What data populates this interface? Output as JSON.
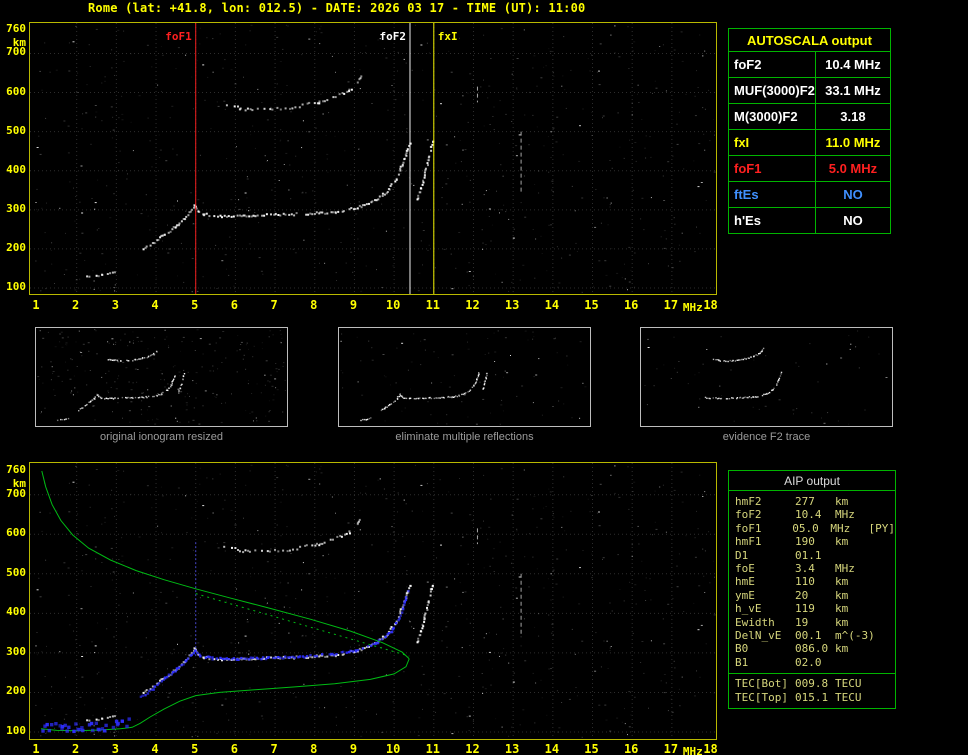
{
  "title": "Rome (lat: +41.8, lon: 012.5) - DATE: 2026 03 17 - TIME (UT): 11:00",
  "colors": {
    "background": "#000000",
    "axis_text": "#ffff00",
    "plot_border": "#b9b900",
    "trace": "#ffffff",
    "restored_trace": "#2e2eff",
    "profile": "#00bb14",
    "table_border": "#00b400",
    "autoscala_title": "#ffff00",
    "aip_text": "#d6d67c",
    "caption": "#9c9c9c"
  },
  "autoscala_table": {
    "title": "AUTOSCALA output",
    "rows": [
      {
        "label": "foF2",
        "value": "10.4 MHz",
        "color": "#ffffff"
      },
      {
        "label": "MUF(3000)F2",
        "value": "33.1 MHz",
        "color": "#ffffff"
      },
      {
        "label": "M(3000)F2",
        "value": "3.18",
        "color": "#ffffff"
      },
      {
        "label": "fxI",
        "value": "11.0 MHz",
        "color": "#ffff00"
      },
      {
        "label": "foF1",
        "value": "5.0 MHz",
        "color": "#ff2020"
      },
      {
        "label": "ftEs",
        "value": "NO",
        "color": "#4090ff"
      },
      {
        "label": "h'Es",
        "value": "NO",
        "color": "#ffffff"
      }
    ]
  },
  "thumbnails": [
    {
      "caption": "original ionogram resized"
    },
    {
      "caption": "eliminate multiple reflections"
    },
    {
      "caption": "evidence F2 trace"
    }
  ],
  "aip_table": {
    "title": "AIP output",
    "rows": [
      {
        "name": "hmF2",
        "value": "277",
        "unit": "km",
        "note": ""
      },
      {
        "name": "foF2",
        "value": "10.4",
        "unit": "MHz",
        "note": ""
      },
      {
        "name": "foF1",
        "value": "05.0",
        "unit": "MHz",
        "note": "[PY]"
      },
      {
        "name": "hmF1",
        "value": "190",
        "unit": "km",
        "note": ""
      },
      {
        "name": "D1",
        "value": "01.1",
        "unit": "",
        "note": ""
      },
      {
        "name": "foE",
        "value": "3.4",
        "unit": "MHz",
        "note": ""
      },
      {
        "name": "hmE",
        "value": "110",
        "unit": "km",
        "note": ""
      },
      {
        "name": "ymE",
        "value": "20",
        "unit": "km",
        "note": ""
      },
      {
        "name": "h_vE",
        "value": "119",
        "unit": "km",
        "note": ""
      },
      {
        "name": "Ewidth",
        "value": "19",
        "unit": "km",
        "note": ""
      },
      {
        "name": "DelN_vE",
        "value": "00.1",
        "unit": "m^(-3)",
        "note": ""
      },
      {
        "name": "B0",
        "value": "086.0",
        "unit": "km",
        "note": ""
      },
      {
        "name": "B1",
        "value": "02.0",
        "unit": "",
        "note": ""
      }
    ],
    "tec_rows": [
      {
        "name": "TEC[Bot]",
        "value": "009.8",
        "unit": "TECU",
        "note": ""
      },
      {
        "name": "TEC[Top]",
        "value": "015.1",
        "unit": "TECU",
        "note": ""
      }
    ]
  },
  "chart_data": {
    "type": "scatter",
    "title": "Ionogram - Rome - 2026 03 17 11:00 UT",
    "xlabel": "MHz",
    "ylabel": "km",
    "xlim": [
      1,
      18
    ],
    "ylim": [
      85,
      778
    ],
    "x_ticks": [
      1,
      2,
      3,
      4,
      5,
      6,
      7,
      8,
      9,
      10,
      11,
      12,
      13,
      14,
      15,
      16,
      17,
      18
    ],
    "y_ticks": [
      760,
      700,
      600,
      500,
      400,
      300,
      200,
      100
    ],
    "grid": "dotted",
    "markers": [
      {
        "name": "foF1",
        "freq": 5.0,
        "color": "#ff2020",
        "label_side": "left"
      },
      {
        "name": "foF2",
        "freq": 10.4,
        "color": "#ffffff",
        "label_side": "left"
      },
      {
        "name": "fxI",
        "freq": 11.0,
        "color": "#ffff00",
        "label_side": "right"
      }
    ],
    "traces": {
      "e_trace": [
        [
          2.25,
          130
        ],
        [
          2.6,
          134
        ],
        [
          2.95,
          142
        ]
      ],
      "f1_trace": [
        [
          3.65,
          200
        ],
        [
          3.9,
          215
        ],
        [
          4.2,
          240
        ],
        [
          4.5,
          262
        ],
        [
          4.75,
          285
        ],
        [
          4.95,
          315
        ],
        [
          5.05,
          300
        ],
        [
          5.2,
          290
        ]
      ],
      "f2_trace": [
        [
          5.2,
          290
        ],
        [
          5.6,
          286
        ],
        [
          6.2,
          287
        ],
        [
          7.0,
          289
        ],
        [
          7.8,
          292
        ],
        [
          8.5,
          297
        ],
        [
          9.0,
          306
        ],
        [
          9.4,
          320
        ],
        [
          9.8,
          348
        ],
        [
          10.05,
          385
        ],
        [
          10.2,
          420
        ],
        [
          10.3,
          450
        ],
        [
          10.38,
          475
        ]
      ],
      "x_trace": [
        [
          10.55,
          330
        ],
        [
          10.65,
          355
        ],
        [
          10.75,
          390
        ],
        [
          10.85,
          430
        ],
        [
          10.92,
          465
        ],
        [
          10.95,
          480
        ]
      ],
      "second_echo": [
        [
          5.7,
          568
        ],
        [
          6.1,
          562
        ],
        [
          6.6,
          558
        ],
        [
          7.1,
          560
        ],
        [
          7.6,
          567
        ],
        [
          8.1,
          577
        ],
        [
          8.5,
          590
        ],
        [
          8.85,
          607
        ],
        [
          9.05,
          628
        ],
        [
          9.2,
          648
        ]
      ]
    },
    "restored_trace": {
      "e": [
        [
          1.1,
          118
        ],
        [
          1.6,
          116
        ],
        [
          2.1,
          114
        ],
        [
          2.6,
          116
        ],
        [
          3.0,
          122
        ],
        [
          3.3,
          130
        ]
      ],
      "f": [
        [
          3.6,
          190
        ],
        [
          3.9,
          212
        ],
        [
          4.2,
          238
        ],
        [
          4.5,
          262
        ],
        [
          4.75,
          285
        ],
        [
          4.95,
          308
        ],
        [
          5.1,
          295
        ],
        [
          5.4,
          289
        ],
        [
          6.0,
          288
        ],
        [
          6.8,
          290
        ],
        [
          7.6,
          293
        ],
        [
          8.4,
          299
        ],
        [
          9.0,
          309
        ],
        [
          9.5,
          326
        ],
        [
          9.9,
          355
        ],
        [
          10.1,
          390
        ],
        [
          10.25,
          430
        ],
        [
          10.32,
          458
        ]
      ]
    },
    "profile": {
      "topside": [
        [
          1.12,
          760
        ],
        [
          1.22,
          720
        ],
        [
          1.38,
          675
        ],
        [
          1.6,
          635
        ],
        [
          1.9,
          598
        ],
        [
          2.3,
          565
        ],
        [
          2.85,
          535
        ],
        [
          3.5,
          508
        ],
        [
          4.2,
          485
        ],
        [
          5.0,
          462
        ],
        [
          5.9,
          438
        ],
        [
          6.9,
          412
        ],
        [
          7.9,
          385
        ],
        [
          8.9,
          355
        ],
        [
          9.7,
          326
        ],
        [
          10.2,
          302
        ],
        [
          10.38,
          285
        ]
      ],
      "bottomside": [
        [
          10.38,
          285
        ],
        [
          10.3,
          265
        ],
        [
          10.0,
          247
        ],
        [
          9.4,
          233
        ],
        [
          8.5,
          222
        ],
        [
          7.5,
          214
        ],
        [
          6.5,
          207
        ],
        [
          5.6,
          200
        ],
        [
          5.0,
          192
        ],
        [
          4.6,
          178
        ],
        [
          4.2,
          158
        ],
        [
          3.85,
          138
        ],
        [
          3.6,
          122
        ],
        [
          3.4,
          112
        ],
        [
          3.1,
          108
        ],
        [
          2.6,
          105
        ],
        [
          2.0,
          103
        ],
        [
          1.5,
          104
        ],
        [
          1.1,
          108
        ]
      ],
      "fit_dotted": [
        [
          5.0,
          450
        ],
        [
          10.38,
          292
        ]
      ],
      "f1_vertical": {
        "freq": 5.0,
        "km_range": [
          292,
          580
        ]
      }
    },
    "interference_streaks": [
      {
        "freq": 13.2,
        "km_range": [
          340,
          500
        ]
      },
      {
        "freq": 12.1,
        "km_range": [
          575,
          615
        ]
      }
    ]
  }
}
